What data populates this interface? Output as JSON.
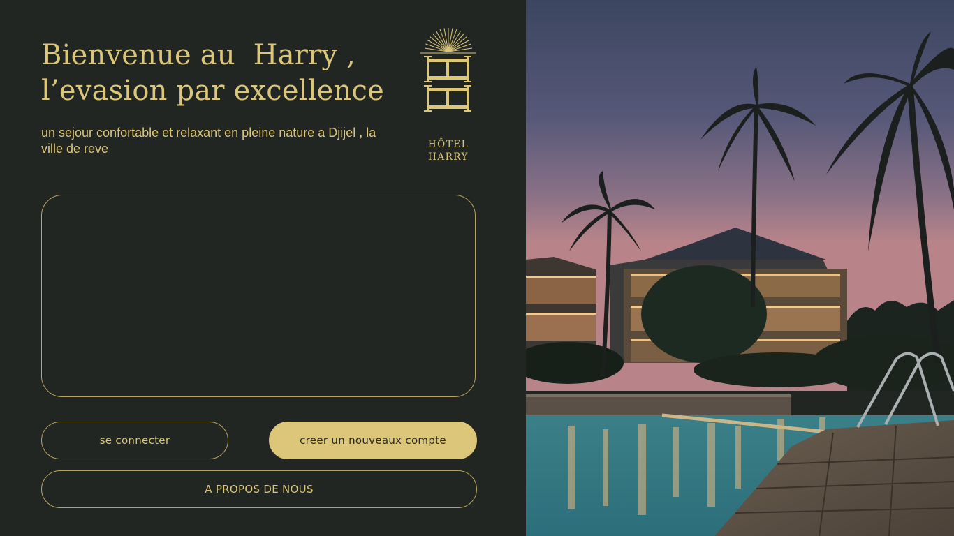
{
  "welcome": {
    "headline_line1": "Bienvenue au  Harry ,",
    "headline_line2": "l’evasion par excellence",
    "subtitle": "un sejour confortable et relaxant en pleine nature a Djijel , la ville de reve"
  },
  "logo": {
    "monogram": "HH",
    "name_line1": "HÔTEL",
    "name_line2": "HARRY"
  },
  "buttons": {
    "login": "se connecter",
    "register": "creer un nouveaux compte",
    "about": "A PROPOS DE NOUS"
  },
  "photo": {
    "subject": "hotel at dusk with palm trees and swimming pool"
  },
  "colors": {
    "background": "#222622",
    "accent_gold": "#dcc67a"
  }
}
